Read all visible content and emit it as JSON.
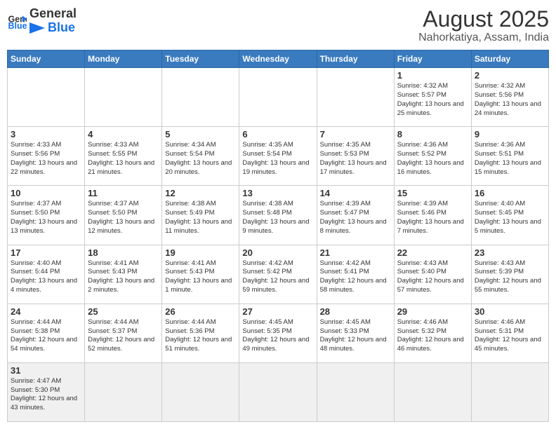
{
  "logo": {
    "text_general": "General",
    "text_blue": "Blue"
  },
  "header": {
    "month": "August 2025",
    "location": "Nahorkatiya, Assam, India"
  },
  "weekdays": [
    "Sunday",
    "Monday",
    "Tuesday",
    "Wednesday",
    "Thursday",
    "Friday",
    "Saturday"
  ],
  "weeks": [
    [
      {
        "day": "",
        "info": ""
      },
      {
        "day": "",
        "info": ""
      },
      {
        "day": "",
        "info": ""
      },
      {
        "day": "",
        "info": ""
      },
      {
        "day": "",
        "info": ""
      },
      {
        "day": "1",
        "info": "Sunrise: 4:32 AM\nSunset: 5:57 PM\nDaylight: 13 hours and 25 minutes."
      },
      {
        "day": "2",
        "info": "Sunrise: 4:32 AM\nSunset: 5:56 PM\nDaylight: 13 hours and 24 minutes."
      }
    ],
    [
      {
        "day": "3",
        "info": "Sunrise: 4:33 AM\nSunset: 5:56 PM\nDaylight: 13 hours and 22 minutes."
      },
      {
        "day": "4",
        "info": "Sunrise: 4:33 AM\nSunset: 5:55 PM\nDaylight: 13 hours and 21 minutes."
      },
      {
        "day": "5",
        "info": "Sunrise: 4:34 AM\nSunset: 5:54 PM\nDaylight: 13 hours and 20 minutes."
      },
      {
        "day": "6",
        "info": "Sunrise: 4:35 AM\nSunset: 5:54 PM\nDaylight: 13 hours and 19 minutes."
      },
      {
        "day": "7",
        "info": "Sunrise: 4:35 AM\nSunset: 5:53 PM\nDaylight: 13 hours and 17 minutes."
      },
      {
        "day": "8",
        "info": "Sunrise: 4:36 AM\nSunset: 5:52 PM\nDaylight: 13 hours and 16 minutes."
      },
      {
        "day": "9",
        "info": "Sunrise: 4:36 AM\nSunset: 5:51 PM\nDaylight: 13 hours and 15 minutes."
      }
    ],
    [
      {
        "day": "10",
        "info": "Sunrise: 4:37 AM\nSunset: 5:50 PM\nDaylight: 13 hours and 13 minutes."
      },
      {
        "day": "11",
        "info": "Sunrise: 4:37 AM\nSunset: 5:50 PM\nDaylight: 13 hours and 12 minutes."
      },
      {
        "day": "12",
        "info": "Sunrise: 4:38 AM\nSunset: 5:49 PM\nDaylight: 13 hours and 11 minutes."
      },
      {
        "day": "13",
        "info": "Sunrise: 4:38 AM\nSunset: 5:48 PM\nDaylight: 13 hours and 9 minutes."
      },
      {
        "day": "14",
        "info": "Sunrise: 4:39 AM\nSunset: 5:47 PM\nDaylight: 13 hours and 8 minutes."
      },
      {
        "day": "15",
        "info": "Sunrise: 4:39 AM\nSunset: 5:46 PM\nDaylight: 13 hours and 7 minutes."
      },
      {
        "day": "16",
        "info": "Sunrise: 4:40 AM\nSunset: 5:45 PM\nDaylight: 13 hours and 5 minutes."
      }
    ],
    [
      {
        "day": "17",
        "info": "Sunrise: 4:40 AM\nSunset: 5:44 PM\nDaylight: 13 hours and 4 minutes."
      },
      {
        "day": "18",
        "info": "Sunrise: 4:41 AM\nSunset: 5:43 PM\nDaylight: 13 hours and 2 minutes."
      },
      {
        "day": "19",
        "info": "Sunrise: 4:41 AM\nSunset: 5:43 PM\nDaylight: 13 hours and 1 minute."
      },
      {
        "day": "20",
        "info": "Sunrise: 4:42 AM\nSunset: 5:42 PM\nDaylight: 12 hours and 59 minutes."
      },
      {
        "day": "21",
        "info": "Sunrise: 4:42 AM\nSunset: 5:41 PM\nDaylight: 12 hours and 58 minutes."
      },
      {
        "day": "22",
        "info": "Sunrise: 4:43 AM\nSunset: 5:40 PM\nDaylight: 12 hours and 57 minutes."
      },
      {
        "day": "23",
        "info": "Sunrise: 4:43 AM\nSunset: 5:39 PM\nDaylight: 12 hours and 55 minutes."
      }
    ],
    [
      {
        "day": "24",
        "info": "Sunrise: 4:44 AM\nSunset: 5:38 PM\nDaylight: 12 hours and 54 minutes."
      },
      {
        "day": "25",
        "info": "Sunrise: 4:44 AM\nSunset: 5:37 PM\nDaylight: 12 hours and 52 minutes."
      },
      {
        "day": "26",
        "info": "Sunrise: 4:44 AM\nSunset: 5:36 PM\nDaylight: 12 hours and 51 minutes."
      },
      {
        "day": "27",
        "info": "Sunrise: 4:45 AM\nSunset: 5:35 PM\nDaylight: 12 hours and 49 minutes."
      },
      {
        "day": "28",
        "info": "Sunrise: 4:45 AM\nSunset: 5:33 PM\nDaylight: 12 hours and 48 minutes."
      },
      {
        "day": "29",
        "info": "Sunrise: 4:46 AM\nSunset: 5:32 PM\nDaylight: 12 hours and 46 minutes."
      },
      {
        "day": "30",
        "info": "Sunrise: 4:46 AM\nSunset: 5:31 PM\nDaylight: 12 hours and 45 minutes."
      }
    ],
    [
      {
        "day": "31",
        "info": "Sunrise: 4:47 AM\nSunset: 5:30 PM\nDaylight: 12 hours and 43 minutes."
      },
      {
        "day": "",
        "info": ""
      },
      {
        "day": "",
        "info": ""
      },
      {
        "day": "",
        "info": ""
      },
      {
        "day": "",
        "info": ""
      },
      {
        "day": "",
        "info": ""
      },
      {
        "day": "",
        "info": ""
      }
    ]
  ]
}
